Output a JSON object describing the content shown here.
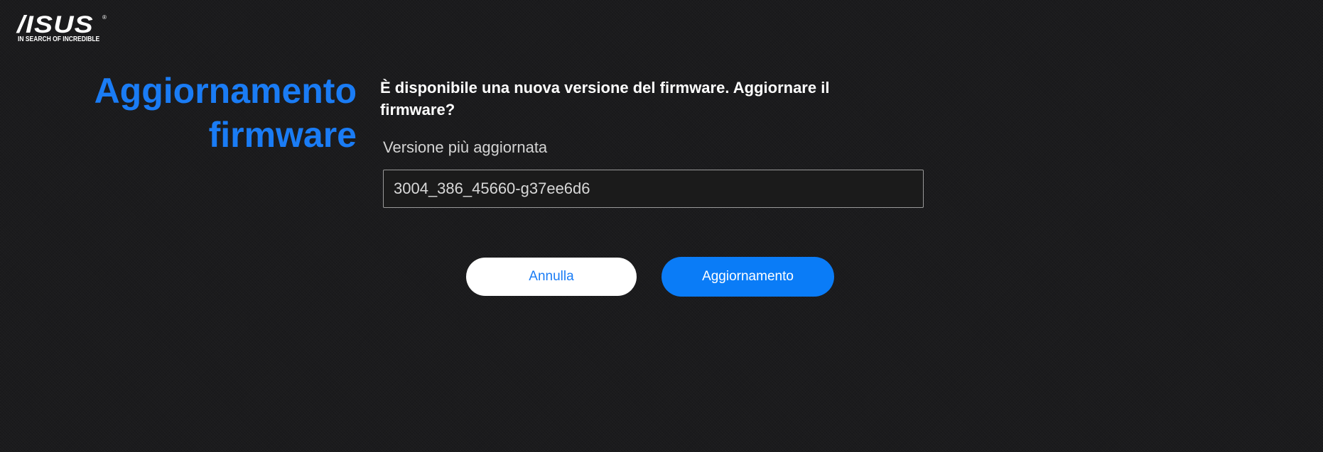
{
  "brand": {
    "logo_text": "/ISUS",
    "registered": "®",
    "tagline": "IN SEARCH OF INCREDIBLE"
  },
  "page": {
    "title_line1": "Aggiornamento",
    "title_line2": "firmware"
  },
  "dialog": {
    "question": "È disponibile una nuova versione del firmware. Aggiornare il firmware?",
    "latest_version_label": "Versione più aggiornata",
    "latest_version_value": "3004_386_45660-g37ee6d6"
  },
  "actions": {
    "cancel_label": "Annulla",
    "update_label": "Aggiornamento"
  },
  "colors": {
    "accent": "#1a7cf5",
    "background": "#1b1b1d",
    "primary_button": "#0a7cf7"
  }
}
